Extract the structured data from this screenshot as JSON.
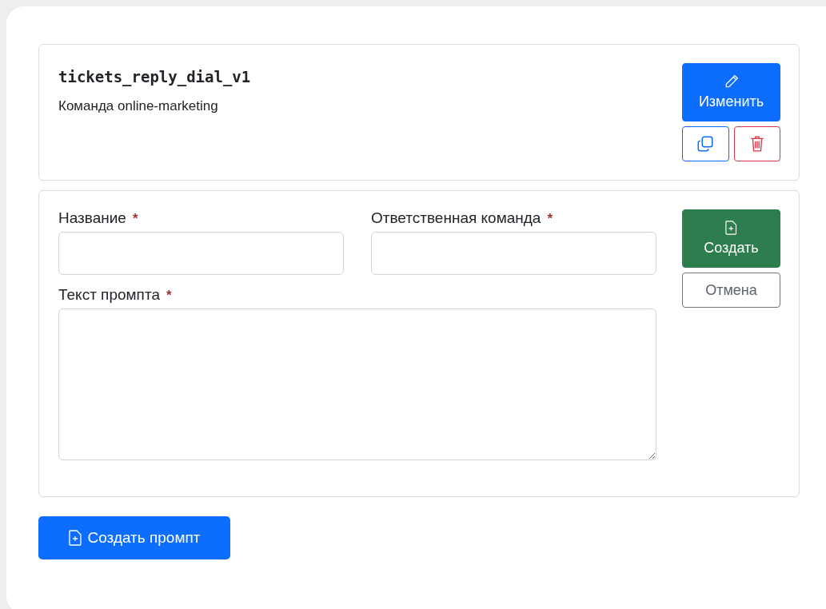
{
  "prompt_card": {
    "title": "tickets_reply_dial_v1",
    "team": "Команда online-marketing",
    "edit_button": "Изменить"
  },
  "form": {
    "fields": [
      {
        "label": "Название",
        "required_mark": "*",
        "kind": "input"
      },
      {
        "label": "Ответственная команда",
        "required_mark": "*",
        "kind": "input"
      },
      {
        "label": "Текст промпта",
        "required_mark": "*",
        "kind": "textarea"
      }
    ],
    "submit_button": "Создать",
    "cancel_button": "Отмена"
  },
  "create_prompt_button": "Создать промпт"
}
